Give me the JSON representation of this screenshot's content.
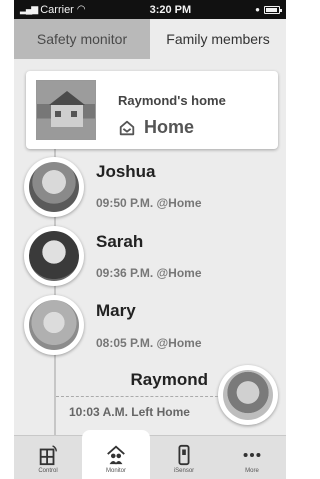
{
  "statusbar": {
    "carrier": "Carrier",
    "time": "3:20 PM"
  },
  "tabs": [
    {
      "label": "Safety monitor",
      "active": true
    },
    {
      "label": "Family members",
      "active": false
    }
  ],
  "home_card": {
    "title": "Raymond's home",
    "status": "Home"
  },
  "members": [
    {
      "name": "Joshua",
      "status": "09:50 P.M. @Home"
    },
    {
      "name": "Sarah",
      "status": "09:36 P.M. @Home"
    },
    {
      "name": "Mary",
      "status": "08:05 P.M. @Home"
    },
    {
      "name": "Raymond",
      "status": "10:03 A.M. Left Home"
    }
  ],
  "tabbar": [
    {
      "label": "Control",
      "icon": "control-panel-icon",
      "active": false
    },
    {
      "label": "Monitor",
      "icon": "family-house-icon",
      "active": true
    },
    {
      "label": "iSensor",
      "icon": "sensor-device-icon",
      "active": false
    },
    {
      "label": "More",
      "icon": "more-dots-icon",
      "active": false
    }
  ]
}
